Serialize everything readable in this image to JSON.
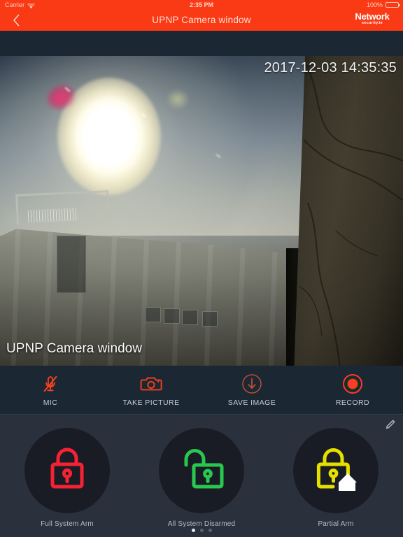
{
  "status_bar": {
    "carrier": "Carrier",
    "wifi_icon": "wifi-icon",
    "time": "2:35 PM",
    "battery_percent": "100%",
    "battery_icon": "battery-full-icon"
  },
  "nav": {
    "back_icon": "chevron-left-icon",
    "title": "UPNP Camera window",
    "brand_main": "Network",
    "brand_sub": "security.ie",
    "bar_color": "#f93a15"
  },
  "video": {
    "timestamp": "2017-12-03 14:35:35",
    "caption": "UPNP Camera window"
  },
  "controls": [
    {
      "label": "MIC",
      "icon": "microphone-muted-icon",
      "color": "#f4401c"
    },
    {
      "label": "TAKE PICTURE",
      "icon": "camera-icon",
      "color": "#f4401c"
    },
    {
      "label": "SAVE IMAGE",
      "icon": "download-arrow-circle-icon",
      "color": "#c4512f"
    },
    {
      "label": "RECORD",
      "icon": "record-circle-icon",
      "color": "#f4401c"
    }
  ],
  "arm_panel": {
    "edit_icon": "pencil-edit-icon",
    "modes": [
      {
        "label": "Full System Arm",
        "icon": "lock-closed-icon",
        "color": "#f52233"
      },
      {
        "label": "All System Disarmed",
        "icon": "lock-open-icon",
        "color": "#28c84e"
      },
      {
        "label": "Partial Arm",
        "icon": "lock-home-icon",
        "color": "#e6e000"
      }
    ],
    "pager": {
      "count": 3,
      "active_index": 0
    }
  },
  "theme": {
    "accent": "#f93a15",
    "panel_bg": "#2a303c",
    "bar_bg": "#1c2734",
    "circle_bg": "#191c24"
  }
}
